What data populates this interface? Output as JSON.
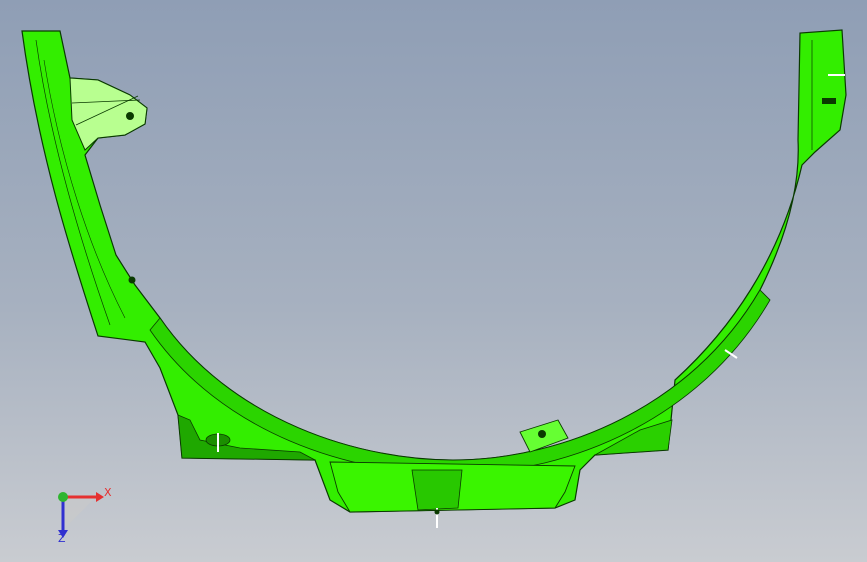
{
  "viewport": {
    "background_top": "#8f9eb5",
    "background_bottom": "#c9ccd1"
  },
  "model": {
    "part_color": "#33ee00",
    "edge_color": "#0a3a00",
    "shade_color": "#1fa800",
    "highlight_color": "#ccffaa"
  },
  "triad": {
    "x_label": "X",
    "z_label": "Z",
    "x_color": "#e53030",
    "y_color": "#2fb52f",
    "z_color": "#3030d0"
  }
}
